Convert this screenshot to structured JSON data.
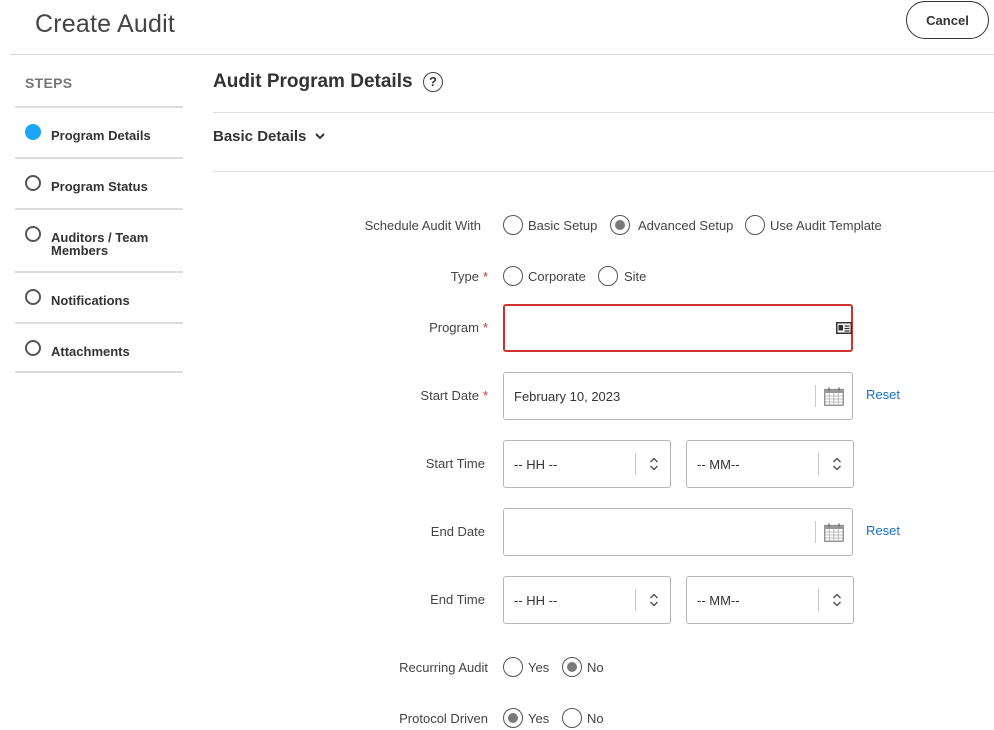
{
  "header": {
    "title": "Create Audit",
    "cancel_label": "Cancel"
  },
  "sidebar": {
    "heading": "STEPS",
    "steps": [
      {
        "label": "Program Details",
        "state": "active"
      },
      {
        "label": "Program Status",
        "state": "pending"
      },
      {
        "label": "Auditors / Team Members",
        "state": "pending"
      },
      {
        "label": "Notifications",
        "state": "pending"
      },
      {
        "label": "Attachments",
        "state": "pending"
      }
    ]
  },
  "main": {
    "title": "Audit Program Details",
    "help_glyph": "?",
    "section": {
      "label": "Basic Details"
    },
    "form": {
      "schedule_with": {
        "label": "Schedule Audit With",
        "options": [
          "Basic Setup",
          "Advanced Setup",
          "Use Audit Template"
        ],
        "selected": "Advanced Setup"
      },
      "type": {
        "label": "Type",
        "required_mark": "*",
        "options": [
          "Corporate",
          "Site"
        ],
        "selected": null
      },
      "program": {
        "label": "Program",
        "required_mark": "*",
        "value": "",
        "state": "error"
      },
      "start_date": {
        "label": "Start Date",
        "required_mark": "*",
        "value": "February 10, 2023",
        "reset_label": "Reset"
      },
      "start_time": {
        "label": "Start Time",
        "hours_value": "-- HH --",
        "minutes_value": "-- MM--"
      },
      "end_date": {
        "label": "End Date",
        "value": "",
        "reset_label": "Reset"
      },
      "end_time": {
        "label": "End Time",
        "hours_value": "-- HH --",
        "minutes_value": "-- MM--"
      },
      "recurring_audit": {
        "label": "Recurring Audit",
        "options": [
          "Yes",
          "No"
        ],
        "selected": "No"
      },
      "protocol_driven": {
        "label": "Protocol Driven",
        "options": [
          "Yes",
          "No"
        ],
        "selected": "Yes"
      }
    }
  },
  "colors": {
    "active_step": "#1ba5f5",
    "error_border": "#d0312d",
    "link": "#1a6fc9",
    "required": "#d0312d"
  },
  "icons": [
    "help-icon",
    "chevron-down-icon",
    "id-card-icon",
    "calendar-icon",
    "spinner-arrows-icon"
  ]
}
